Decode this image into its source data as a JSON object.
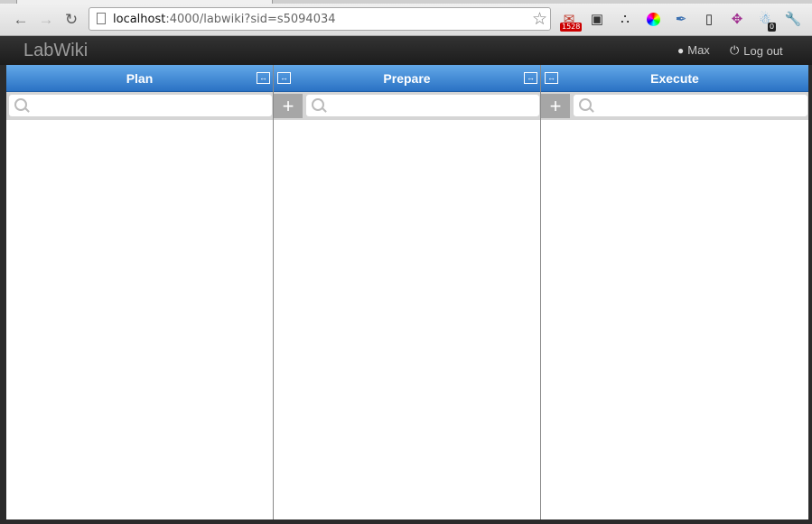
{
  "browser": {
    "url_host": "localhost",
    "url_rest": ":4000/labwiki?sid=s5094034",
    "back_icon": "back-arrow-icon",
    "forward_icon": "forward-arrow-icon",
    "reload_icon": "reload-icon",
    "bookmark_icon": "star-icon",
    "extensions": [
      {
        "name": "mail-extension-icon"
      },
      {
        "name": "evernote-icon"
      },
      {
        "name": "dots-extension-icon"
      },
      {
        "name": "color-wheel-icon"
      },
      {
        "name": "eyedropper-icon"
      },
      {
        "name": "mobile-icon"
      },
      {
        "name": "move-tool-icon"
      },
      {
        "name": "ghostery-icon"
      },
      {
        "name": "wrench-icon"
      }
    ],
    "badge_mail": "1528",
    "badge_ghost": "0"
  },
  "navbar": {
    "brand": "LabWiki",
    "user": "Max",
    "logout": "Log out"
  },
  "columns": [
    {
      "title": "Plan",
      "search_placeholder": ""
    },
    {
      "title": "Prepare",
      "search_placeholder": "",
      "add_label": "+"
    },
    {
      "title": "Execute",
      "search_placeholder": "",
      "add_label": "+"
    }
  ],
  "colors": {
    "header_top": "#63a8e8",
    "header_bottom": "#2a72c4",
    "navbar": "#1c1c1c"
  }
}
